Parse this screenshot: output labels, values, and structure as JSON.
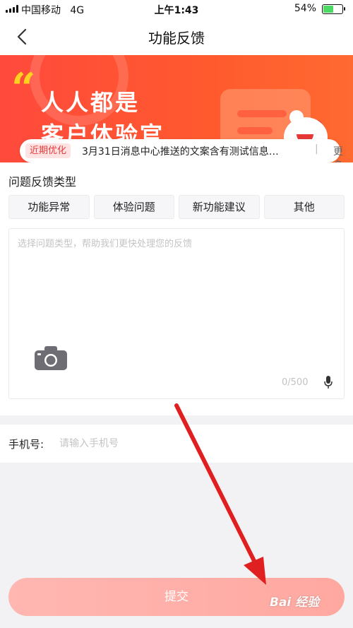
{
  "status_bar": {
    "carrier": "中国移动",
    "network": "4G",
    "time": "上午1:43",
    "battery_percent": "54%",
    "battery_level": 0.54
  },
  "nav": {
    "title": "功能反馈",
    "back_icon": "chevron-left-icon"
  },
  "banner": {
    "slogan_line1": "人人都是",
    "slogan_line2": "客户体验官",
    "quote_mark": "“"
  },
  "notice": {
    "tag": "近期优化",
    "text": "3月31日消息中心推送的文案含有测试信息…",
    "separator": "|",
    "more": "更多"
  },
  "feedback": {
    "section_label": "问题反馈类型",
    "types": [
      "功能异常",
      "体验问题",
      "新功能建议",
      "其他"
    ],
    "placeholder": "选择问题类型，帮助我们更快处理您的反馈",
    "counter": "0/500",
    "camera_icon": "camera-icon",
    "mic_icon": "microphone-icon"
  },
  "phone": {
    "label": "手机号:",
    "placeholder": "请输入手机号"
  },
  "submit": {
    "label": "提交"
  },
  "watermark": {
    "text": "Bai 经验"
  },
  "colors": {
    "accent": "#ff4a3c",
    "tag_bg": "#ffe3e3",
    "tag_text": "#e53b3b",
    "submit_bg": "#ffb7b2",
    "annotation_arrow": "#e02020"
  }
}
